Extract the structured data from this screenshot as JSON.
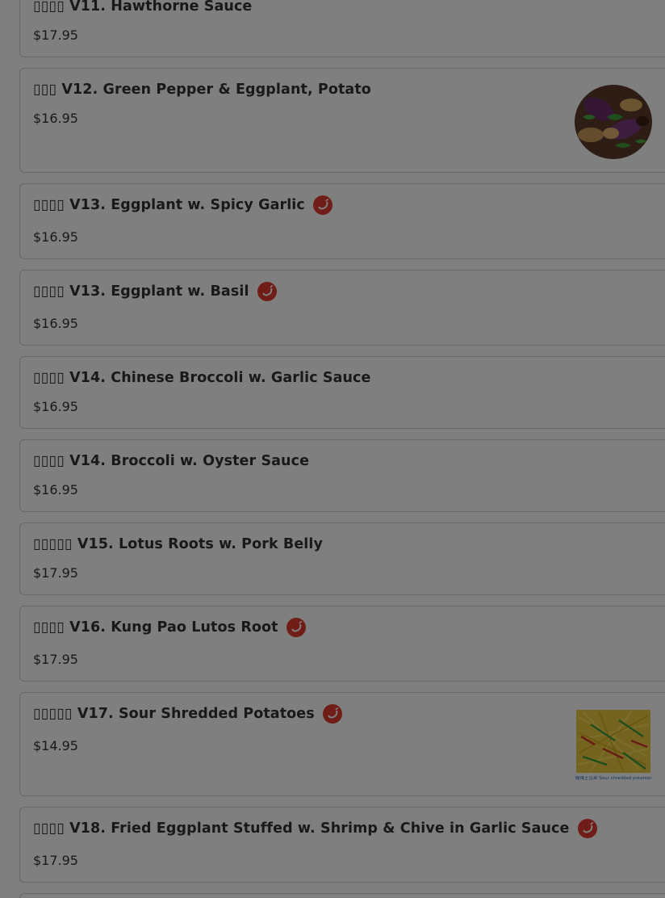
{
  "menu": {
    "items": [
      {
        "name": "▯▯▯▯ V11. Hawthorne Sauce",
        "price": "$17.95",
        "spicy": false
      },
      {
        "name": "▯▯▯ V12. Green Pepper & Eggplant, Potato",
        "price": "$16.95",
        "spicy": false,
        "image": "eggplant-photo"
      },
      {
        "name": "▯▯▯▯ V13. Eggplant w. Spicy Garlic",
        "price": "$16.95",
        "spicy": true
      },
      {
        "name": "▯▯▯▯ V13. Eggplant w. Basil",
        "price": "$16.95",
        "spicy": true
      },
      {
        "name": "▯▯▯▯ V14. Chinese Broccoli w. Garlic Sauce",
        "price": "$16.95",
        "spicy": false
      },
      {
        "name": "▯▯▯▯ V14. Broccoli w. Oyster Sauce",
        "price": "$16.95",
        "spicy": false
      },
      {
        "name": "▯▯▯▯▯ V15. Lotus Roots w. Pork Belly",
        "price": "$17.95",
        "spicy": false
      },
      {
        "name": "▯▯▯▯ V16. Kung Pao Lutos Root",
        "price": "$17.95",
        "spicy": true
      },
      {
        "name": "▯▯▯▯▯ V17. Sour Shredded Potatoes",
        "price": "$14.95",
        "spicy": true,
        "image": "potato-photo",
        "image_caption": "酸辣土豆丝 Sour shredded potatoes"
      },
      {
        "name": "▯▯▯▯ V18. Fried Eggplant Stuffed w. Shrimp & Chive in Garlic Sauce",
        "price": "$17.95",
        "spicy": true
      }
    ]
  },
  "icons": {
    "spicy": "chili-pepper-icon"
  },
  "colors": {
    "spicy_badge": "#e23a2e",
    "overlay": "rgba(0,0,0,0.5)",
    "text": "#333333"
  }
}
